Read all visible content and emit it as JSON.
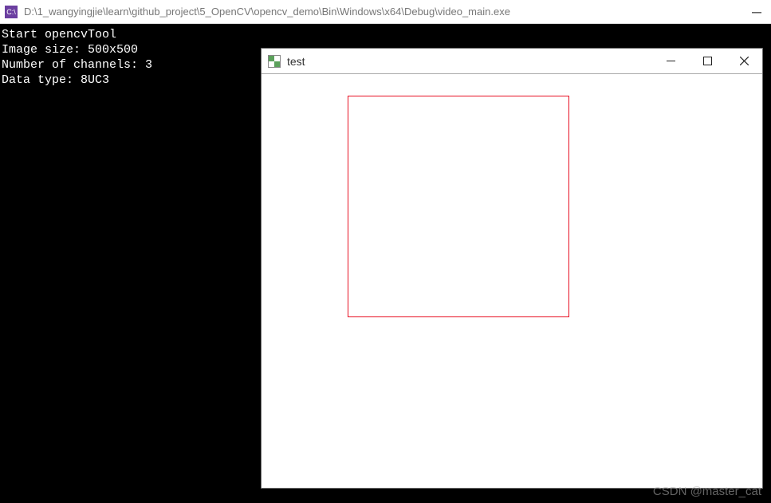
{
  "main_window": {
    "icon_text": "C:\\",
    "title": "D:\\1_wangyingjie\\learn\\github_project\\5_OpenCV\\opencv_demo\\Bin\\Windows\\x64\\Debug\\video_main.exe"
  },
  "console": {
    "lines": [
      "Start opencvTool",
      "Image size: 500x500",
      "Number of channels: 3",
      "Data type: 8UC3"
    ]
  },
  "child_window": {
    "title": "test"
  },
  "watermark": "CSDN @master_cat"
}
